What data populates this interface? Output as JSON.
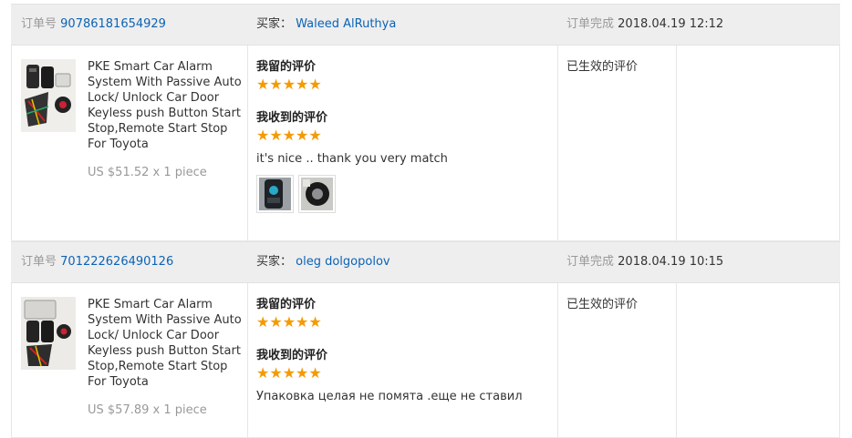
{
  "labels": {
    "order_no": "订单号",
    "buyer": "买家：",
    "completed": "订单完成",
    "my_review": "我留的评价",
    "received_review": "我收到的评价",
    "stars": "★★★★★"
  },
  "orders": [
    {
      "order_id": "90786181654929",
      "buyer_name": "Waleed AlRuthya",
      "completed_at": "2018.04.19 12:12",
      "product_title": "PKE Smart Car Alarm System With Passive Auto Lock/ Unlock Car Door Keyless push Button Start Stop,Remote Start Stop For Toyota",
      "price": "US $51.52 x 1 piece",
      "my_rating": 5,
      "received_rating": 5,
      "received_text": "it's nice .. thank you very match",
      "photos": [
        "review-photo-1",
        "review-photo-2"
      ],
      "status": "已生效的评价"
    },
    {
      "order_id": "701222626490126",
      "buyer_name": "oleg dolgopolov",
      "completed_at": "2018.04.19 10:15",
      "product_title": "PKE Smart Car Alarm System With Passive Auto Lock/ Unlock Car Door Keyless push Button Start Stop,Remote Start Stop For Toyota",
      "price": "US $57.89 x 1 piece",
      "my_rating": 5,
      "received_rating": 5,
      "received_text": "Упаковка целая не помята .еще не ставил",
      "photos": [],
      "status": "已生效的评价"
    }
  ],
  "colors": {
    "link": "#0b63b6",
    "star": "#f59a00",
    "header_bg": "#eeeeee",
    "muted": "#999999"
  }
}
